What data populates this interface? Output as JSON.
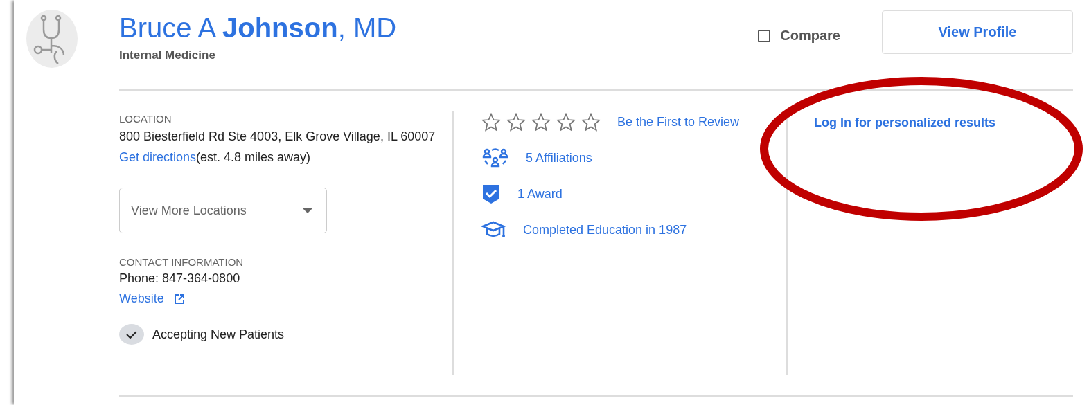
{
  "provider": {
    "name": "Bruce A **Johnson**, MD",
    "specialty": "Internal Medicine"
  },
  "compare": {
    "label": "Compare",
    "checked": false
  },
  "view_profile_button": "View Profile",
  "location": {
    "heading": "LOCATION",
    "address": "800 Biesterfield Rd Ste 4003, Elk Grove Village, IL 60007",
    "directions_link": "Get directions",
    "distance": "(est. 4.8 miles away)",
    "more_locations": {
      "placeholder": "View More Locations"
    }
  },
  "contact": {
    "heading": "CONTACT INFORMATION",
    "phone": "Phone: 847-364-0800",
    "website_link": "Website"
  },
  "accepting": {
    "label": "Accepting New Patients",
    "checked": true
  },
  "rating": {
    "stars": 0,
    "review_link": "Be the First to Review"
  },
  "highlights": [
    {
      "kind": "affiliations",
      "label": "5 Affiliations"
    },
    {
      "kind": "award",
      "label": "1 Award"
    },
    {
      "kind": "education",
      "label": "Completed Education in 1987"
    }
  ],
  "login_link": "Log In for personalized results"
}
